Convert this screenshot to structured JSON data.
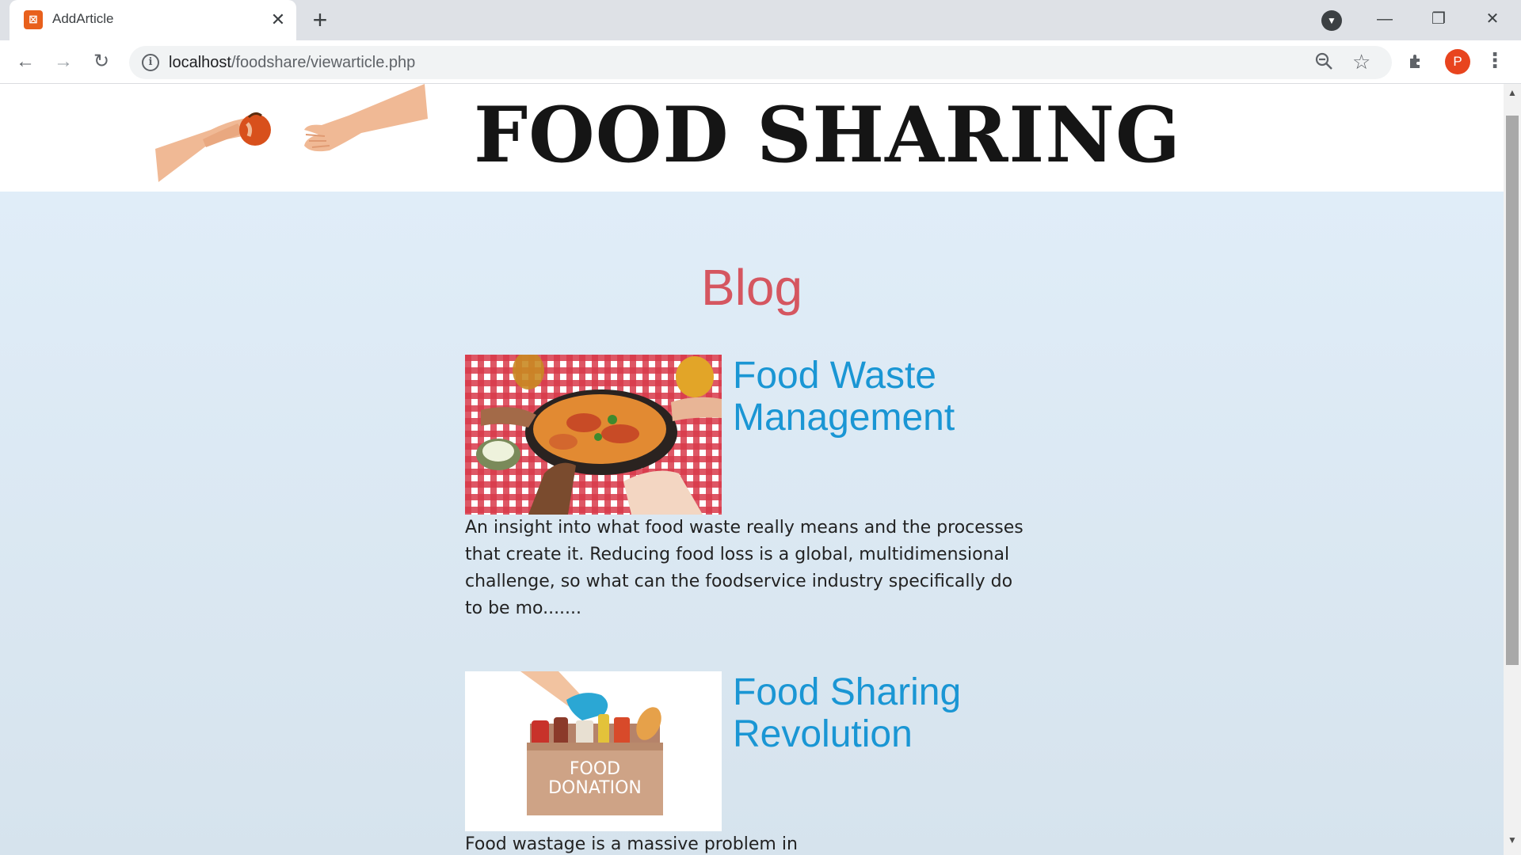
{
  "browser": {
    "tab_title": "AddArticle",
    "tab_close": "✕",
    "new_tab": "+",
    "url_host": "localhost",
    "url_path": "/foodshare/viewarticle.php",
    "avatar_letter": "P",
    "favicon_glyph": "⊠",
    "window_buttons": {
      "minimize": "—",
      "restore": "❐",
      "close": "✕"
    }
  },
  "site": {
    "title": "FOOD SHARING"
  },
  "blog": {
    "heading": "Blog",
    "articles": [
      {
        "title": "Food Waste Management",
        "excerpt": "An insight into what food waste really means and the processes that create it. Reducing food loss is a global, multidimensional challenge, so what can the foodservice industry specifically do to be mo.......",
        "image": "pizza-sharing-photo"
      },
      {
        "title": "Food Sharing Revolution",
        "excerpt": "Food wastage is a massive problem in",
        "image": "food-donation-illustration",
        "image_text_line1": "FOOD",
        "image_text_line2": "DONATION"
      }
    ]
  },
  "colors": {
    "blog_heading": "#d55660",
    "article_title": "#1a96d4",
    "content_bg_top": "#e0edf8"
  }
}
